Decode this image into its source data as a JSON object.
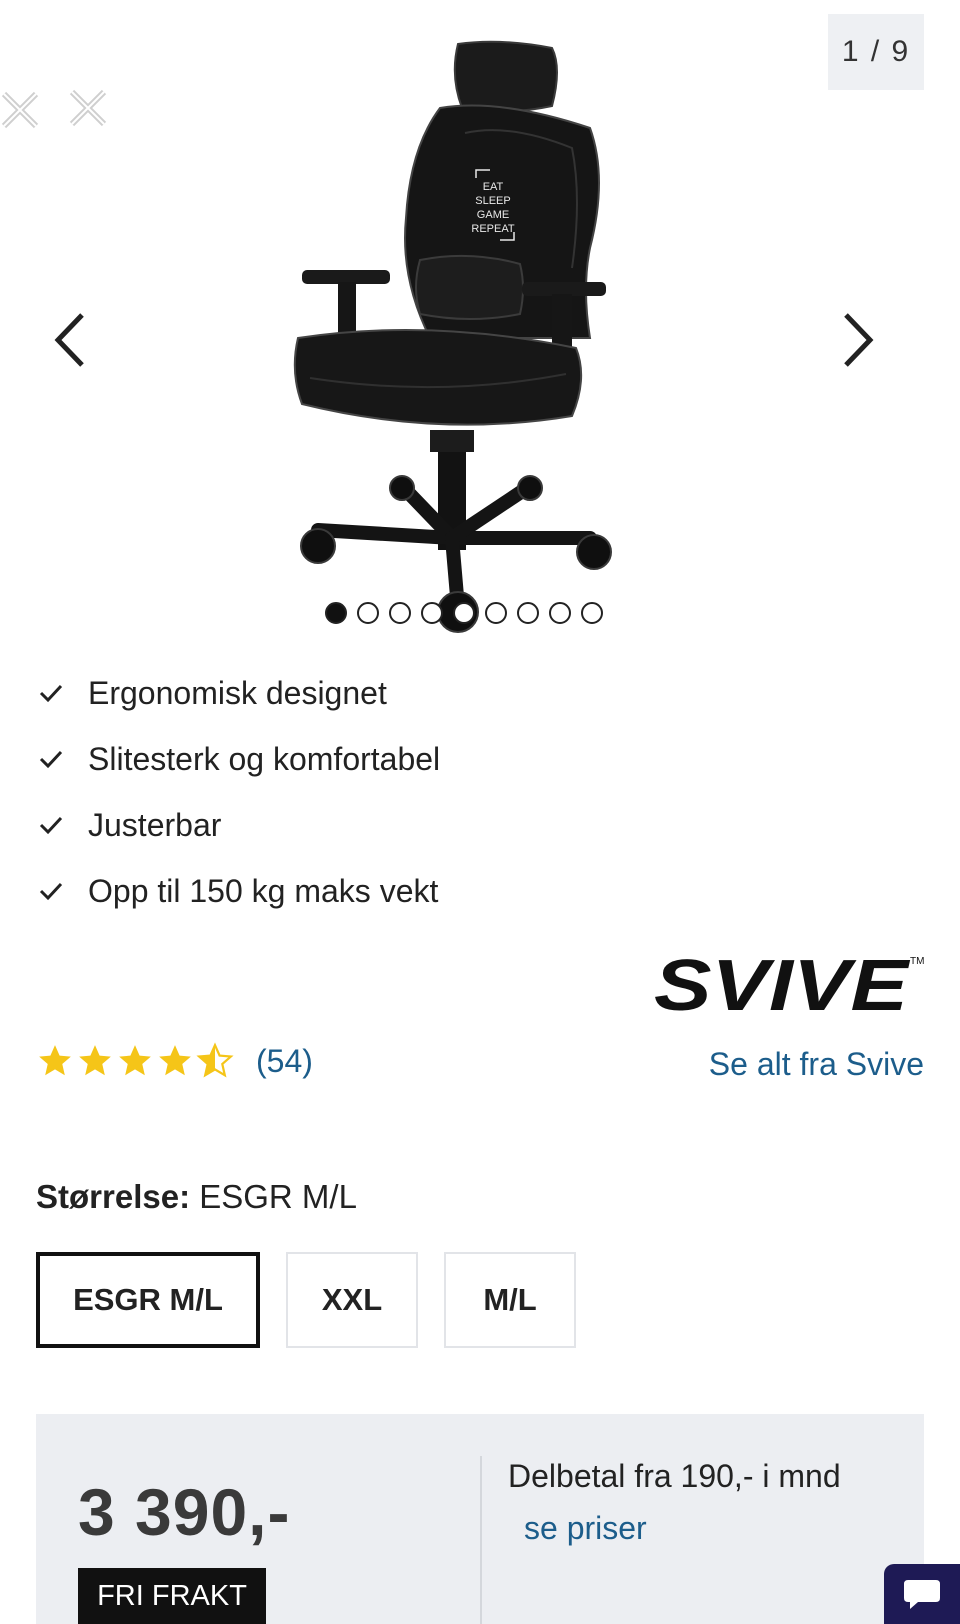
{
  "gallery": {
    "counter": "1 / 9",
    "image_alt": "Svive gaming chair",
    "chair_print": [
      "EAT",
      "SLEEP",
      "GAME",
      "REPEAT"
    ],
    "dots": [
      true,
      false,
      false,
      false,
      false,
      false,
      false,
      false,
      false
    ]
  },
  "features": [
    "Ergonomisk designet",
    "Slitesterk og komfortabel",
    "Justerbar",
    "Opp til 150 kg maks vekt"
  ],
  "brand": {
    "logo_text": "SVIVE",
    "link_label": "Se alt fra Svive"
  },
  "rating": {
    "stars": 4.5,
    "count_label": "(54)"
  },
  "size": {
    "label": "Størrelse:",
    "selected": "ESGR M/L",
    "options": [
      "ESGR M/L",
      "XXL",
      "M/L"
    ]
  },
  "price": {
    "amount": "3 390,-",
    "shipping_badge": "FRI FRAKT",
    "installment": "Delbetal fra 190,- i mnd",
    "see_prices": "se priser"
  },
  "colors": {
    "link": "#1c5d8b",
    "star": "#f5c518",
    "panel": "#eceef2",
    "chat": "#1e1a55"
  }
}
